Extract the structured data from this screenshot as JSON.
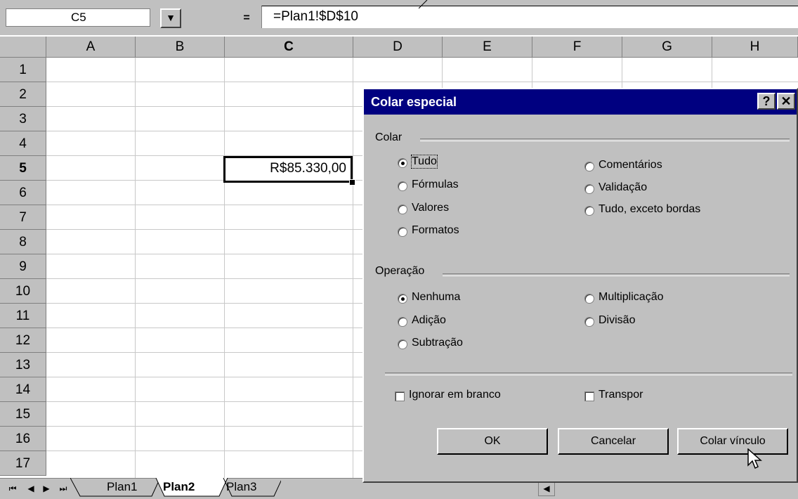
{
  "formula_bar": {
    "name_box": "C5",
    "dropdown": "▼",
    "equals": "=",
    "formula": "=Plan1!$D$10"
  },
  "grid": {
    "columns": [
      "A",
      "B",
      "C",
      "D",
      "E",
      "F",
      "G",
      "H"
    ],
    "active_column": "C",
    "rows": [
      "1",
      "2",
      "3",
      "4",
      "5",
      "6",
      "7",
      "8",
      "9",
      "10",
      "11",
      "12",
      "13",
      "14",
      "15",
      "16",
      "17"
    ],
    "active_row": "5",
    "active_cell_value": "R$85.330,00"
  },
  "sheet_tabs": {
    "tabs": [
      "Plan1",
      "Plan2",
      "Plan3"
    ],
    "active": "Plan2"
  },
  "dialog": {
    "title": "Colar especial",
    "help_button": "?",
    "close_button": "✕",
    "paste_group": {
      "label": "Colar",
      "options": [
        {
          "label": "Tudo",
          "selected": true
        },
        {
          "label": "Fórmulas",
          "selected": false
        },
        {
          "label": "Valores",
          "selected": false
        },
        {
          "label": "Formatos",
          "selected": false
        },
        {
          "label": "Comentários",
          "selected": false
        },
        {
          "label": "Validação",
          "selected": false
        },
        {
          "label": "Tudo, exceto bordas",
          "selected": false
        }
      ]
    },
    "operation_group": {
      "label": "Operação",
      "options": [
        {
          "label": "Nenhuma",
          "selected": true
        },
        {
          "label": "Adição",
          "selected": false
        },
        {
          "label": "Subtração",
          "selected": false
        },
        {
          "label": "Multiplicação",
          "selected": false
        },
        {
          "label": "Divisão",
          "selected": false
        }
      ]
    },
    "checkboxes": [
      {
        "label": "Ignorar em branco",
        "checked": false
      },
      {
        "label": "Transpor",
        "checked": false
      }
    ],
    "buttons": {
      "ok": "OK",
      "cancel": "Cancelar",
      "paste_link": "Colar vínculo"
    }
  }
}
